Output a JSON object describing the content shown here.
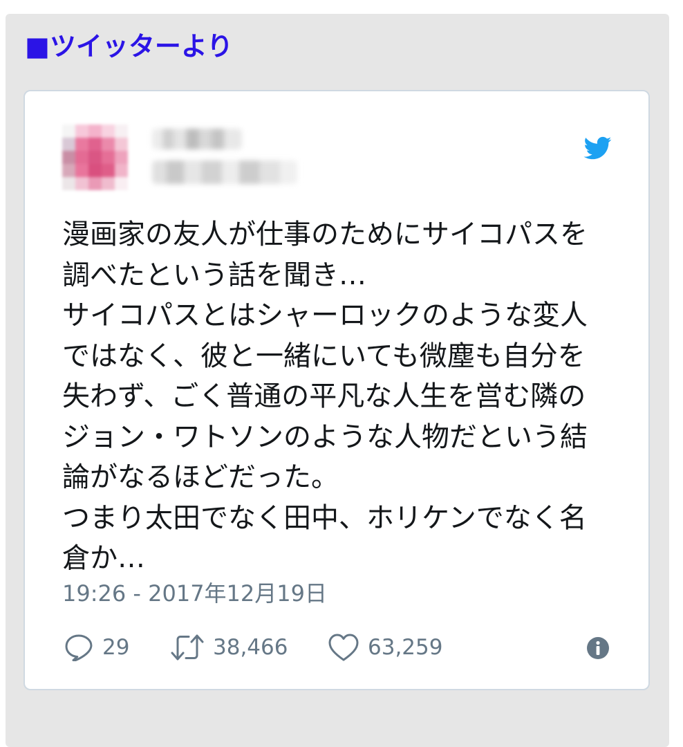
{
  "section": {
    "title": "■ツイッターより",
    "title_color": "#2b14e6",
    "background": "#e6e6e6"
  },
  "tweet": {
    "user": {
      "display_name": "",
      "handle": "",
      "avatar_obscured": true
    },
    "brand_icon": "twitter-bird-icon",
    "brand_color": "#1da1f2",
    "text_lines": [
      "漫画家の友人が仕事のためにサイコパスを",
      "調べたという話を聞き…",
      "サイコパスとはシャーロックのような変人",
      "ではなく、彼と一緒にいても微塵も自分を",
      "失わず、ごく普通の平凡な人生を営む隣の",
      "ジョン・ワトソンのような人物だという結",
      "論がなるほどだった。",
      "つまり太田でなく田中、ホリケンでなく名",
      "倉か…"
    ],
    "timestamp": "19:26 - 2017年12月19日",
    "actions": {
      "reply": {
        "icon": "reply-icon",
        "count": "29"
      },
      "retweet": {
        "icon": "retweet-icon",
        "count": "38,466"
      },
      "like": {
        "icon": "heart-icon",
        "count": "63,259"
      },
      "info": {
        "icon": "info-icon"
      }
    },
    "meta_color": "#657786",
    "text_color": "#14171a"
  }
}
